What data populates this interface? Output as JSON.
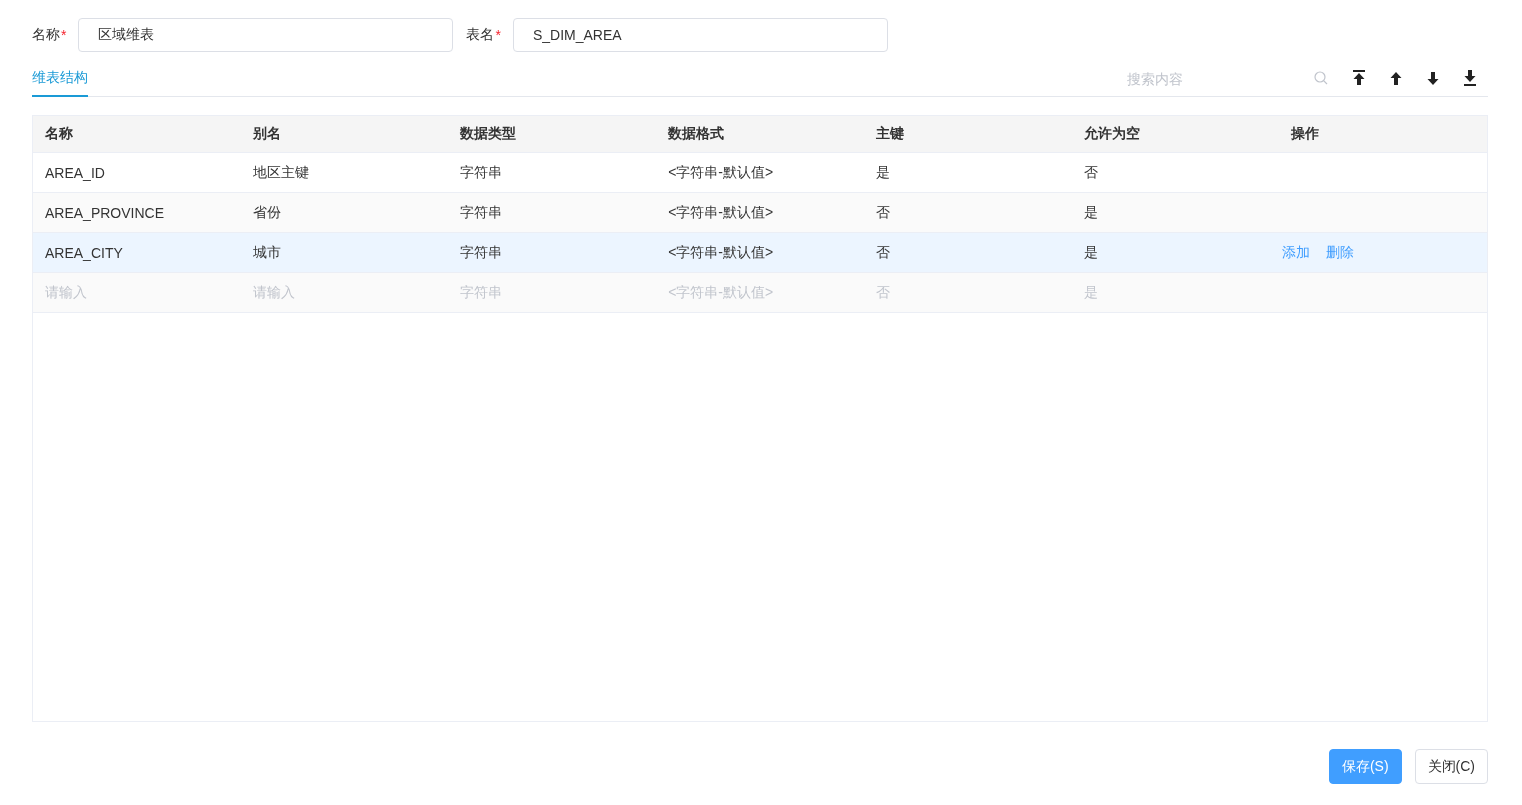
{
  "fields": [
    {
      "label": "名称",
      "required_mark": "*",
      "value": "区域维表"
    },
    {
      "label": "表名",
      "required_mark": "*",
      "value": "S_DIM_AREA"
    }
  ],
  "tabs": [
    {
      "label": "维表结构",
      "selected": true
    }
  ],
  "toolbar": {
    "search_placeholder": "搜索内容"
  },
  "table": {
    "columns": [
      "名称",
      "别名",
      "数据类型",
      "数据格式",
      "主键",
      "允许为空",
      "操作"
    ],
    "rows": [
      {
        "kind": "data",
        "selected": false,
        "cells": [
          "AREA_ID",
          "地区主键",
          "字符串",
          "<字符串-默认值>",
          "是",
          "否"
        ]
      },
      {
        "kind": "data",
        "selected": false,
        "cells": [
          "AREA_PROVINCE",
          "省份",
          "字符串",
          "<字符串-默认值>",
          "否",
          "是"
        ]
      },
      {
        "kind": "data",
        "selected": true,
        "cells": [
          "AREA_CITY",
          "城市",
          "字符串",
          "<字符串-默认值>",
          "否",
          "是"
        ],
        "actions": [
          "添加",
          "删除"
        ]
      },
      {
        "kind": "placeholder",
        "selected": false,
        "cells": [
          "请输入",
          "请输入",
          "字符串",
          "<字符串-默认值>",
          "否",
          "是"
        ]
      }
    ]
  },
  "buttons": [
    {
      "label": "保存(S)",
      "kind": "primary"
    },
    {
      "label": "关闭(C)",
      "kind": "default"
    }
  ]
}
